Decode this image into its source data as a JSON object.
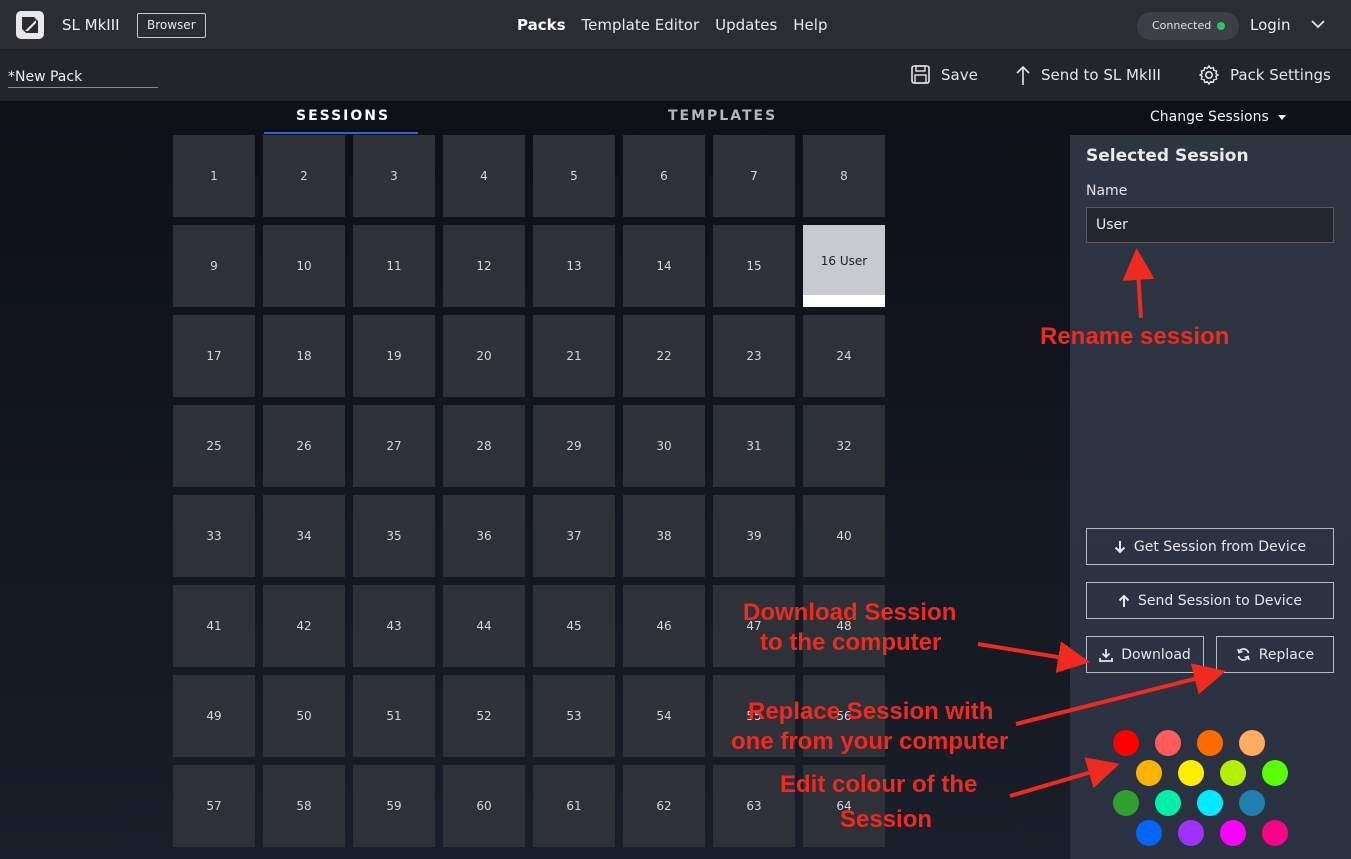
{
  "header": {
    "app_title": "SL MkIII",
    "badge": "Browser",
    "nav": [
      "Packs",
      "Template Editor",
      "Updates",
      "Help"
    ],
    "active_nav": "Packs",
    "connection_status": "Connected",
    "login": "Login"
  },
  "toolbar": {
    "pack_name": "*New Pack",
    "save": "Save",
    "send": "Send to SL MkIII",
    "settings": "Pack Settings"
  },
  "tabs": {
    "sessions": "SESSIONS",
    "templates": "TEMPLATES"
  },
  "sessions": [
    "1",
    "2",
    "3",
    "4",
    "5",
    "6",
    "7",
    "8",
    "9",
    "10",
    "11",
    "12",
    "13",
    "14",
    "15",
    "16 User",
    "17",
    "18",
    "19",
    "20",
    "21",
    "22",
    "23",
    "24",
    "25",
    "26",
    "27",
    "28",
    "29",
    "30",
    "31",
    "32",
    "33",
    "34",
    "35",
    "36",
    "37",
    "38",
    "39",
    "40",
    "41",
    "42",
    "43",
    "44",
    "45",
    "46",
    "47",
    "48",
    "49",
    "50",
    "51",
    "52",
    "53",
    "54",
    "55",
    "56",
    "57",
    "58",
    "59",
    "60",
    "61",
    "62",
    "63",
    "64"
  ],
  "selected_session_index": 15,
  "panel": {
    "change_sessions": "Change Sessions",
    "title": "Selected Session",
    "name_label": "Name",
    "name_value": "User",
    "get_from_device": "Get Session from Device",
    "send_to_device": "Send Session to Device",
    "download": "Download",
    "replace": "Replace"
  },
  "colors": {
    "swatches": [
      "#ff0000",
      "#ff5c5c",
      "#ff6a00",
      "#ffab62",
      "#ffb300",
      "#ffee00",
      "#b6f000",
      "#57ff00",
      "#2ea02e",
      "#00f0a8",
      "#00eaff",
      "#1f7fad",
      "#0066ff",
      "#a031ff",
      "#ff00ff",
      "#ff0088"
    ],
    "accent": "#2e63d4",
    "annotation": "#ee2b1e",
    "connected": "#2cc36b"
  },
  "annotations": {
    "rename": "Rename session",
    "download_1": "Download Session",
    "download_2": "to the computer",
    "replace_1": "Replace Session with",
    "replace_2": "one from your computer",
    "colour_1": "Edit colour of the",
    "colour_2": "Session"
  }
}
